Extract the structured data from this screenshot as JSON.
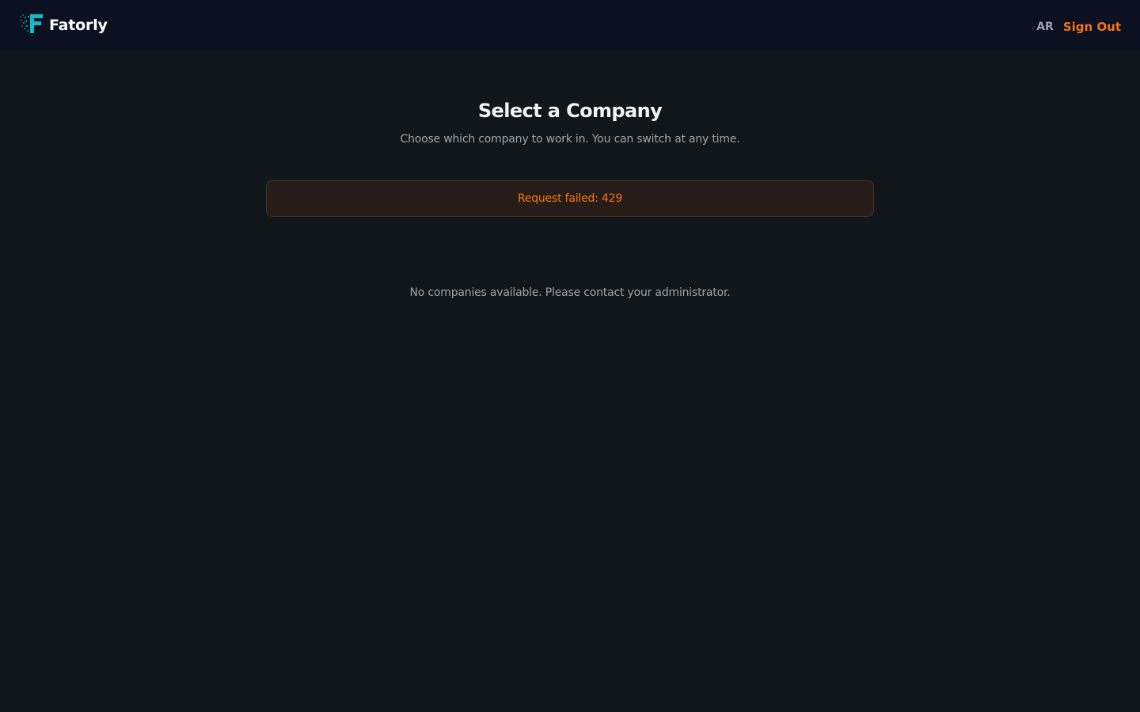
{
  "header": {
    "brand_name": "Fatorly",
    "language_toggle": "AR",
    "sign_out_label": "Sign Out"
  },
  "main": {
    "title": "Select a Company",
    "subtitle": "Choose which company to work in. You can switch at any time.",
    "error_message": "Request failed: 429",
    "empty_state": "No companies available. Please contact your administrator."
  },
  "icons": {
    "logo": "fatorly-logo-icon"
  },
  "colors": {
    "header_bg": "#0b1120",
    "page_bg": "#11161b",
    "accent": "#f97316",
    "logo_teal": "#14b8c8",
    "error_bg": "#271d18"
  }
}
